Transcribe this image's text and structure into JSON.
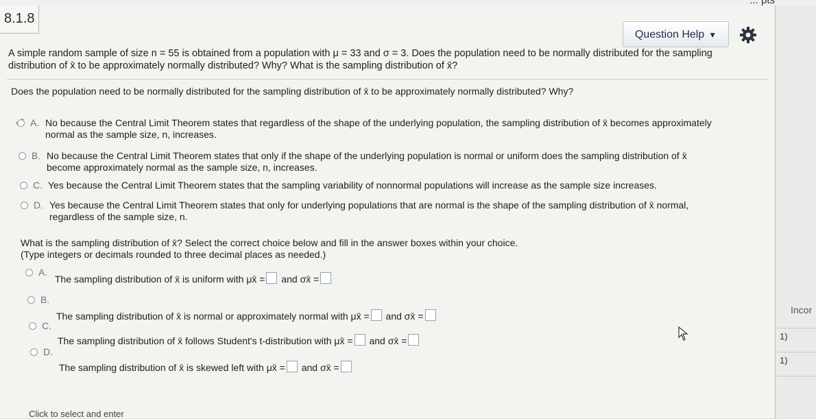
{
  "header": {
    "breadcrumb": "8.1.8",
    "top_partial_text": "... pts",
    "question_help_label": "Question Help"
  },
  "problem": {
    "stem_line1": "A simple random sample of size n = 55 is obtained from a population with μ = 33 and σ = 3. Does the population need to be normally distributed for the sampling",
    "stem_line2": "distribution of x̄ to be approximately normally distributed? Why? What is the sampling distribution of x̄?"
  },
  "part1": {
    "question": "Does the population need to be normally distributed for the sampling distribution of x̄ to be approximately normally distributed? Why?",
    "options": [
      {
        "letter": "A.",
        "line1": "No because the Central Limit Theorem states that regardless of the shape of the underlying population, the sampling distribution of x̄ becomes approximately",
        "line2": "normal as the sample size, n, increases."
      },
      {
        "letter": "B.",
        "line1": "No because the Central Limit Theorem states that only if the shape of the underlying population is normal or uniform does the sampling distribution of x̄",
        "line2": "become approximately normal as the sample size, n, increases."
      },
      {
        "letter": "C.",
        "line1": "Yes because the Central Limit Theorem states that the sampling variability of nonnormal populations will increase as the sample size increases.",
        "line2": ""
      },
      {
        "letter": "D.",
        "line1": "Yes because the Central Limit Theorem states that only for underlying populations that are normal is the shape of the sampling distribution of x̄ normal,",
        "line2": "regardless of the sample size, n."
      }
    ]
  },
  "part2": {
    "question": "What is the sampling distribution of x̄? Select the correct choice below and fill in the answer boxes within your choice.",
    "hint": "(Type integers or decimals rounded to three decimal places as needed.)",
    "options": [
      {
        "letter": "A.",
        "text": "The sampling distribution of x̄ is uniform with μx̄ =",
        "and": "and σx̄ ="
      },
      {
        "letter": "B.",
        "text": "The sampling distribution of x̄ is normal or approximately normal with μx̄ =",
        "and": "and σx̄ ="
      },
      {
        "letter": "C.",
        "text": "The sampling distribution of x̄ follows Student's t-distribution with μx̄ =",
        "and": "and σx̄ ="
      },
      {
        "letter": "D.",
        "text": "The sampling distribution of x̄ is skewed left with μx̄ =",
        "and": "and σx̄ ="
      }
    ]
  },
  "footer": {
    "hint": "Click to select and enter"
  },
  "sidebar": {
    "status": "Incor",
    "item1": "1)",
    "item2": "1)"
  }
}
